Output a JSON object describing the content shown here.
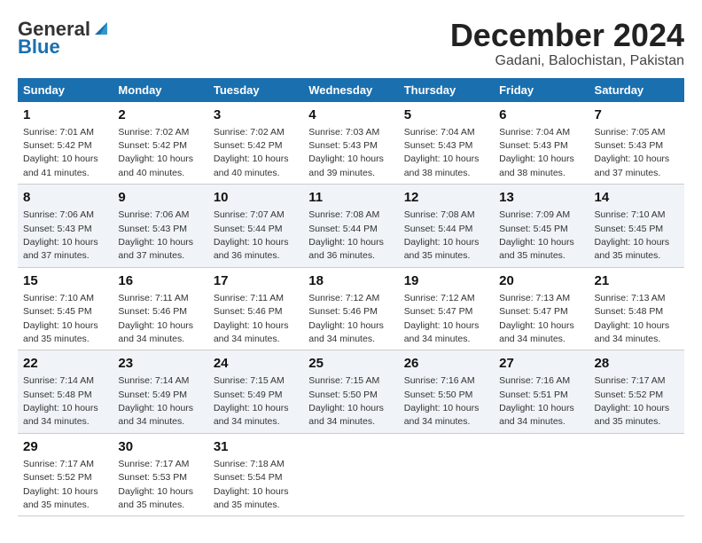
{
  "logo": {
    "line1": "General",
    "line2": "Blue",
    "subtitle": ""
  },
  "header": {
    "month": "December 2024",
    "location": "Gadani, Balochistan, Pakistan"
  },
  "weekdays": [
    "Sunday",
    "Monday",
    "Tuesday",
    "Wednesday",
    "Thursday",
    "Friday",
    "Saturday"
  ],
  "weeks": [
    [
      {
        "day": "1",
        "sunrise": "Sunrise: 7:01 AM",
        "sunset": "Sunset: 5:42 PM",
        "daylight": "Daylight: 10 hours and 41 minutes."
      },
      {
        "day": "2",
        "sunrise": "Sunrise: 7:02 AM",
        "sunset": "Sunset: 5:42 PM",
        "daylight": "Daylight: 10 hours and 40 minutes."
      },
      {
        "day": "3",
        "sunrise": "Sunrise: 7:02 AM",
        "sunset": "Sunset: 5:42 PM",
        "daylight": "Daylight: 10 hours and 40 minutes."
      },
      {
        "day": "4",
        "sunrise": "Sunrise: 7:03 AM",
        "sunset": "Sunset: 5:43 PM",
        "daylight": "Daylight: 10 hours and 39 minutes."
      },
      {
        "day": "5",
        "sunrise": "Sunrise: 7:04 AM",
        "sunset": "Sunset: 5:43 PM",
        "daylight": "Daylight: 10 hours and 38 minutes."
      },
      {
        "day": "6",
        "sunrise": "Sunrise: 7:04 AM",
        "sunset": "Sunset: 5:43 PM",
        "daylight": "Daylight: 10 hours and 38 minutes."
      },
      {
        "day": "7",
        "sunrise": "Sunrise: 7:05 AM",
        "sunset": "Sunset: 5:43 PM",
        "daylight": "Daylight: 10 hours and 37 minutes."
      }
    ],
    [
      {
        "day": "8",
        "sunrise": "Sunrise: 7:06 AM",
        "sunset": "Sunset: 5:43 PM",
        "daylight": "Daylight: 10 hours and 37 minutes."
      },
      {
        "day": "9",
        "sunrise": "Sunrise: 7:06 AM",
        "sunset": "Sunset: 5:43 PM",
        "daylight": "Daylight: 10 hours and 37 minutes."
      },
      {
        "day": "10",
        "sunrise": "Sunrise: 7:07 AM",
        "sunset": "Sunset: 5:44 PM",
        "daylight": "Daylight: 10 hours and 36 minutes."
      },
      {
        "day": "11",
        "sunrise": "Sunrise: 7:08 AM",
        "sunset": "Sunset: 5:44 PM",
        "daylight": "Daylight: 10 hours and 36 minutes."
      },
      {
        "day": "12",
        "sunrise": "Sunrise: 7:08 AM",
        "sunset": "Sunset: 5:44 PM",
        "daylight": "Daylight: 10 hours and 35 minutes."
      },
      {
        "day": "13",
        "sunrise": "Sunrise: 7:09 AM",
        "sunset": "Sunset: 5:45 PM",
        "daylight": "Daylight: 10 hours and 35 minutes."
      },
      {
        "day": "14",
        "sunrise": "Sunrise: 7:10 AM",
        "sunset": "Sunset: 5:45 PM",
        "daylight": "Daylight: 10 hours and 35 minutes."
      }
    ],
    [
      {
        "day": "15",
        "sunrise": "Sunrise: 7:10 AM",
        "sunset": "Sunset: 5:45 PM",
        "daylight": "Daylight: 10 hours and 35 minutes."
      },
      {
        "day": "16",
        "sunrise": "Sunrise: 7:11 AM",
        "sunset": "Sunset: 5:46 PM",
        "daylight": "Daylight: 10 hours and 34 minutes."
      },
      {
        "day": "17",
        "sunrise": "Sunrise: 7:11 AM",
        "sunset": "Sunset: 5:46 PM",
        "daylight": "Daylight: 10 hours and 34 minutes."
      },
      {
        "day": "18",
        "sunrise": "Sunrise: 7:12 AM",
        "sunset": "Sunset: 5:46 PM",
        "daylight": "Daylight: 10 hours and 34 minutes."
      },
      {
        "day": "19",
        "sunrise": "Sunrise: 7:12 AM",
        "sunset": "Sunset: 5:47 PM",
        "daylight": "Daylight: 10 hours and 34 minutes."
      },
      {
        "day": "20",
        "sunrise": "Sunrise: 7:13 AM",
        "sunset": "Sunset: 5:47 PM",
        "daylight": "Daylight: 10 hours and 34 minutes."
      },
      {
        "day": "21",
        "sunrise": "Sunrise: 7:13 AM",
        "sunset": "Sunset: 5:48 PM",
        "daylight": "Daylight: 10 hours and 34 minutes."
      }
    ],
    [
      {
        "day": "22",
        "sunrise": "Sunrise: 7:14 AM",
        "sunset": "Sunset: 5:48 PM",
        "daylight": "Daylight: 10 hours and 34 minutes."
      },
      {
        "day": "23",
        "sunrise": "Sunrise: 7:14 AM",
        "sunset": "Sunset: 5:49 PM",
        "daylight": "Daylight: 10 hours and 34 minutes."
      },
      {
        "day": "24",
        "sunrise": "Sunrise: 7:15 AM",
        "sunset": "Sunset: 5:49 PM",
        "daylight": "Daylight: 10 hours and 34 minutes."
      },
      {
        "day": "25",
        "sunrise": "Sunrise: 7:15 AM",
        "sunset": "Sunset: 5:50 PM",
        "daylight": "Daylight: 10 hours and 34 minutes."
      },
      {
        "day": "26",
        "sunrise": "Sunrise: 7:16 AM",
        "sunset": "Sunset: 5:50 PM",
        "daylight": "Daylight: 10 hours and 34 minutes."
      },
      {
        "day": "27",
        "sunrise": "Sunrise: 7:16 AM",
        "sunset": "Sunset: 5:51 PM",
        "daylight": "Daylight: 10 hours and 34 minutes."
      },
      {
        "day": "28",
        "sunrise": "Sunrise: 7:17 AM",
        "sunset": "Sunset: 5:52 PM",
        "daylight": "Daylight: 10 hours and 35 minutes."
      }
    ],
    [
      {
        "day": "29",
        "sunrise": "Sunrise: 7:17 AM",
        "sunset": "Sunset: 5:52 PM",
        "daylight": "Daylight: 10 hours and 35 minutes."
      },
      {
        "day": "30",
        "sunrise": "Sunrise: 7:17 AM",
        "sunset": "Sunset: 5:53 PM",
        "daylight": "Daylight: 10 hours and 35 minutes."
      },
      {
        "day": "31",
        "sunrise": "Sunrise: 7:18 AM",
        "sunset": "Sunset: 5:54 PM",
        "daylight": "Daylight: 10 hours and 35 minutes."
      },
      null,
      null,
      null,
      null
    ]
  ]
}
